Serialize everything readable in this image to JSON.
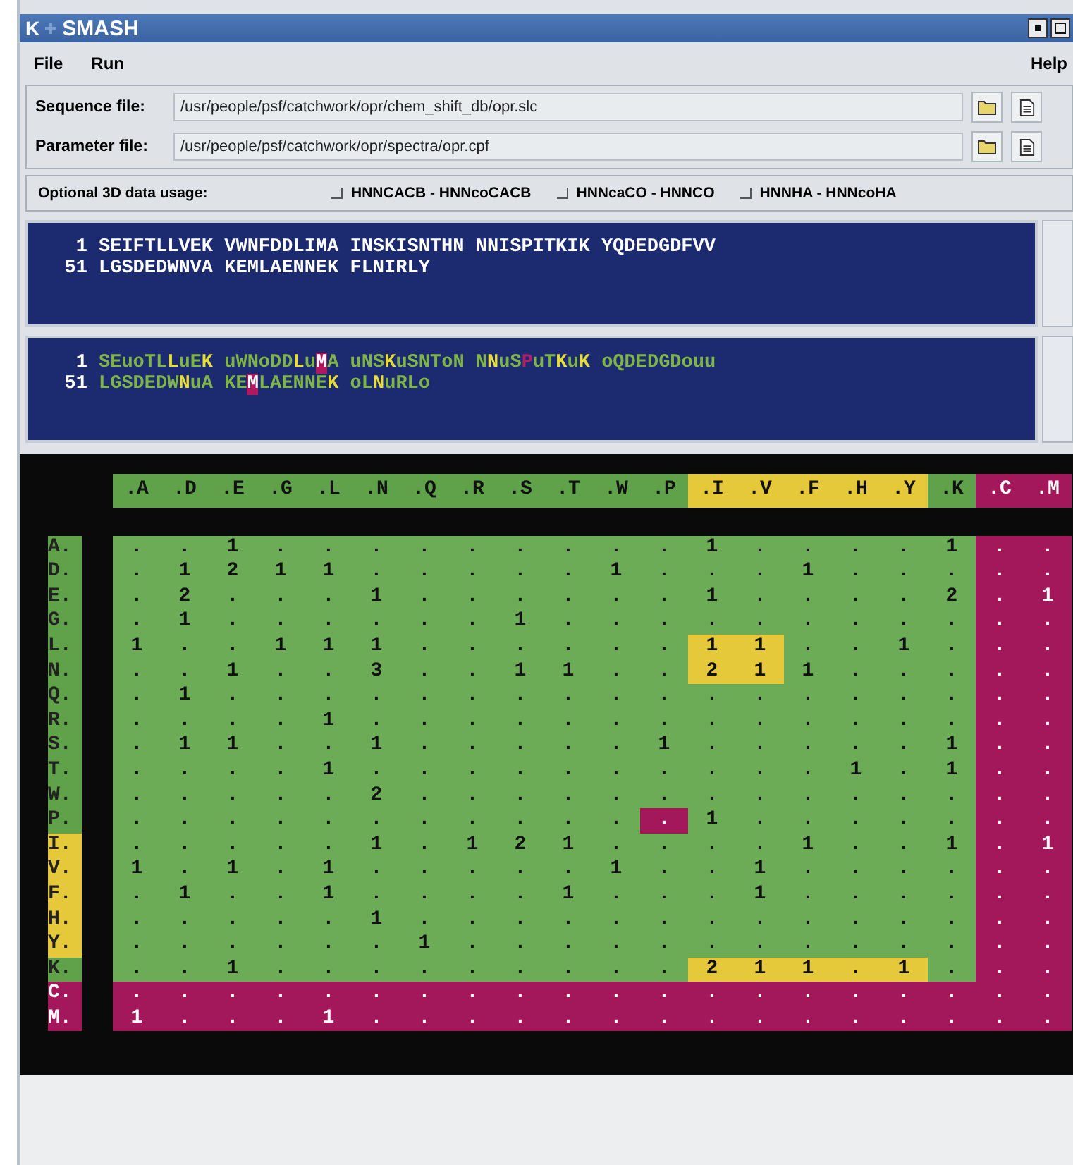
{
  "window": {
    "title": "SMASH",
    "logo": "K"
  },
  "menu": [
    {
      "label": "File"
    },
    {
      "label": "Run"
    },
    {
      "label": "Help"
    }
  ],
  "files": [
    {
      "label": "Sequence file:",
      "value": "/usr/people/psf/catchwork/opr/chem_shift_db/opr.slc"
    },
    {
      "label": "Parameter file:",
      "value": "/usr/people/psf/catchwork/opr/spectra/opr.cpf"
    }
  ],
  "options": {
    "label": "Optional 3D data usage:",
    "items": [
      {
        "label": "HNNCACB - HNNcoCACB",
        "checked": false
      },
      {
        "label": "HNNcaCO - HNNCO",
        "checked": false
      },
      {
        "label": "HNNHA - HNNcoHA",
        "checked": false
      }
    ]
  },
  "sequence": [
    {
      "number": "1",
      "text": "SEIFTLLVEK VWNFDDLIMA INSKISNTHN NNISPITKIK YQDEDGDFVV"
    },
    {
      "number": "51",
      "text": "LGSDEDWNVA KEMLAENNEK FLNIRLY"
    }
  ],
  "assignment": [
    {
      "number": "1",
      "runs": [
        {
          "text": "SEuoTL",
          "kind": "assigned"
        },
        {
          "text": "L",
          "kind": "partial"
        },
        {
          "text": "uE",
          "kind": "assigned"
        },
        {
          "text": "K",
          "kind": "partial"
        },
        {
          "text": " uWNoDD",
          "kind": "assigned"
        },
        {
          "text": "L",
          "kind": "partial"
        },
        {
          "text": "u",
          "kind": "assigned"
        },
        {
          "text": "M",
          "kind": "selected"
        },
        {
          "text": "A uNS",
          "kind": "assigned"
        },
        {
          "text": "K",
          "kind": "partial"
        },
        {
          "text": "uSNToN N",
          "kind": "assigned"
        },
        {
          "text": "N",
          "kind": "partial"
        },
        {
          "text": "uS",
          "kind": "assigned"
        },
        {
          "text": "P",
          "kind": "proline"
        },
        {
          "text": "uT",
          "kind": "assigned"
        },
        {
          "text": "K",
          "kind": "partial"
        },
        {
          "text": "u",
          "kind": "assigned"
        },
        {
          "text": "K",
          "kind": "partial"
        },
        {
          "text": " oQDEDGDouu",
          "kind": "assigned"
        }
      ]
    },
    {
      "number": "51",
      "runs": [
        {
          "text": "LGSDEDW",
          "kind": "assigned"
        },
        {
          "text": "N",
          "kind": "partial"
        },
        {
          "text": "uA KE",
          "kind": "assigned"
        },
        {
          "text": "M",
          "kind": "selected"
        },
        {
          "text": "LAENNE",
          "kind": "assigned"
        },
        {
          "text": "K",
          "kind": "partial"
        },
        {
          "text": " oL",
          "kind": "assigned"
        },
        {
          "text": "N",
          "kind": "partial"
        },
        {
          "text": "uRLo",
          "kind": "assigned"
        }
      ]
    }
  ],
  "matrix": {
    "columns": [
      {
        "label": ".A",
        "kind": "plain"
      },
      {
        "label": ".D",
        "kind": "plain"
      },
      {
        "label": ".E",
        "kind": "plain"
      },
      {
        "label": ".G",
        "kind": "plain"
      },
      {
        "label": ".L",
        "kind": "plain"
      },
      {
        "label": ".N",
        "kind": "plain"
      },
      {
        "label": ".Q",
        "kind": "plain"
      },
      {
        "label": ".R",
        "kind": "plain"
      },
      {
        "label": ".S",
        "kind": "plain"
      },
      {
        "label": ".T",
        "kind": "plain"
      },
      {
        "label": ".W",
        "kind": "plain"
      },
      {
        "label": ".P",
        "kind": "plain"
      },
      {
        "label": ".I",
        "kind": "marked"
      },
      {
        "label": ".V",
        "kind": "marked"
      },
      {
        "label": ".F",
        "kind": "marked"
      },
      {
        "label": ".H",
        "kind": "marked"
      },
      {
        "label": ".Y",
        "kind": "marked"
      },
      {
        "label": ".K",
        "kind": "plain"
      },
      {
        "label": ".C",
        "kind": "excluded"
      },
      {
        "label": ".M",
        "kind": "excluded"
      }
    ],
    "rows": [
      {
        "label": "A.",
        "kind": "plain",
        "cells": [
          ".",
          ".",
          "1",
          ".",
          ".",
          ".",
          ".",
          ".",
          ".",
          ".",
          ".",
          ".",
          "1",
          ".",
          ".",
          ".",
          ".",
          "1",
          ".",
          "."
        ]
      },
      {
        "label": "D.",
        "kind": "plain",
        "cells": [
          ".",
          "1",
          "2",
          "1",
          "1",
          ".",
          ".",
          ".",
          ".",
          ".",
          "1",
          ".",
          ".",
          ".",
          "1",
          ".",
          ".",
          ".",
          ".",
          "."
        ]
      },
      {
        "label": "E.",
        "kind": "plain",
        "cells": [
          ".",
          "2",
          ".",
          ".",
          ".",
          "1",
          ".",
          ".",
          ".",
          ".",
          ".",
          ".",
          "1",
          ".",
          ".",
          ".",
          ".",
          "2",
          ".",
          "1"
        ]
      },
      {
        "label": "G.",
        "kind": "plain",
        "cells": [
          ".",
          "1",
          ".",
          ".",
          ".",
          ".",
          ".",
          ".",
          "1",
          ".",
          ".",
          ".",
          ".",
          ".",
          ".",
          ".",
          ".",
          ".",
          ".",
          "."
        ]
      },
      {
        "label": "L.",
        "kind": "plain",
        "cells": [
          "1",
          ".",
          ".",
          "1",
          "1",
          "1",
          ".",
          ".",
          ".",
          ".",
          ".",
          ".",
          "1",
          "1",
          ".",
          ".",
          "1",
          ".",
          ".",
          "."
        ],
        "highlighted": [
          false,
          false,
          false,
          false,
          false,
          false,
          false,
          false,
          false,
          false,
          false,
          false,
          true,
          true,
          false,
          false,
          false,
          false,
          false,
          false
        ]
      },
      {
        "label": "N.",
        "kind": "plain",
        "cells": [
          ".",
          ".",
          "1",
          ".",
          ".",
          "3",
          ".",
          ".",
          "1",
          "1",
          ".",
          ".",
          "2",
          "1",
          "1",
          ".",
          ".",
          ".",
          ".",
          "."
        ],
        "highlighted": [
          false,
          false,
          false,
          false,
          false,
          false,
          false,
          false,
          false,
          false,
          false,
          false,
          true,
          true,
          false,
          false,
          false,
          false,
          false,
          false
        ]
      },
      {
        "label": "Q.",
        "kind": "plain",
        "cells": [
          ".",
          "1",
          ".",
          ".",
          ".",
          ".",
          ".",
          ".",
          ".",
          ".",
          ".",
          ".",
          ".",
          ".",
          ".",
          ".",
          ".",
          ".",
          ".",
          "."
        ]
      },
      {
        "label": "R.",
        "kind": "plain",
        "cells": [
          ".",
          ".",
          ".",
          ".",
          "1",
          ".",
          ".",
          ".",
          ".",
          ".",
          ".",
          ".",
          ".",
          ".",
          ".",
          ".",
          ".",
          ".",
          ".",
          "."
        ]
      },
      {
        "label": "S.",
        "kind": "plain",
        "cells": [
          ".",
          "1",
          "1",
          ".",
          ".",
          "1",
          ".",
          ".",
          ".",
          ".",
          ".",
          "1",
          ".",
          ".",
          ".",
          ".",
          ".",
          "1",
          ".",
          "."
        ]
      },
      {
        "label": "T.",
        "kind": "plain",
        "cells": [
          ".",
          ".",
          ".",
          ".",
          "1",
          ".",
          ".",
          ".",
          ".",
          ".",
          ".",
          ".",
          ".",
          ".",
          ".",
          "1",
          ".",
          "1",
          ".",
          "."
        ]
      },
      {
        "label": "W.",
        "kind": "plain",
        "cells": [
          ".",
          ".",
          ".",
          ".",
          ".",
          "2",
          ".",
          ".",
          ".",
          ".",
          ".",
          ".",
          ".",
          ".",
          ".",
          ".",
          ".",
          ".",
          ".",
          "."
        ]
      },
      {
        "label": "P.",
        "kind": "plain",
        "cells": [
          ".",
          ".",
          ".",
          ".",
          ".",
          ".",
          ".",
          ".",
          ".",
          ".",
          ".",
          ".",
          "1",
          ".",
          ".",
          ".",
          ".",
          ".",
          ".",
          "."
        ],
        "flagged": [
          false,
          false,
          false,
          false,
          false,
          false,
          false,
          false,
          false,
          false,
          false,
          true,
          false,
          false,
          false,
          false,
          false,
          false,
          false,
          false
        ]
      },
      {
        "label": "I.",
        "kind": "marked",
        "cells": [
          ".",
          ".",
          ".",
          ".",
          ".",
          "1",
          ".",
          "1",
          "2",
          "1",
          ".",
          ".",
          ".",
          ".",
          "1",
          ".",
          ".",
          "1",
          ".",
          "1"
        ]
      },
      {
        "label": "V.",
        "kind": "marked",
        "cells": [
          "1",
          ".",
          "1",
          ".",
          "1",
          ".",
          ".",
          ".",
          ".",
          ".",
          "1",
          ".",
          ".",
          "1",
          ".",
          ".",
          ".",
          ".",
          ".",
          "."
        ]
      },
      {
        "label": "F.",
        "kind": "marked",
        "cells": [
          ".",
          "1",
          ".",
          ".",
          "1",
          ".",
          ".",
          ".",
          ".",
          "1",
          ".",
          ".",
          ".",
          "1",
          ".",
          ".",
          ".",
          ".",
          ".",
          "."
        ]
      },
      {
        "label": "H.",
        "kind": "marked",
        "cells": [
          ".",
          ".",
          ".",
          ".",
          ".",
          "1",
          ".",
          ".",
          ".",
          ".",
          ".",
          ".",
          ".",
          ".",
          ".",
          ".",
          ".",
          ".",
          ".",
          "."
        ]
      },
      {
        "label": "Y.",
        "kind": "marked",
        "cells": [
          ".",
          ".",
          ".",
          ".",
          ".",
          ".",
          "1",
          ".",
          ".",
          ".",
          ".",
          ".",
          ".",
          ".",
          ".",
          ".",
          ".",
          ".",
          ".",
          "."
        ]
      },
      {
        "label": "K.",
        "kind": "plain",
        "cells": [
          ".",
          ".",
          "1",
          ".",
          ".",
          ".",
          ".",
          ".",
          ".",
          ".",
          ".",
          ".",
          "2",
          "1",
          "1",
          ".",
          "1",
          ".",
          ".",
          "."
        ],
        "highlighted": [
          false,
          false,
          false,
          false,
          false,
          false,
          false,
          false,
          false,
          false,
          false,
          false,
          true,
          true,
          true,
          true,
          true,
          false,
          false,
          false
        ]
      },
      {
        "label": "C.",
        "kind": "excluded",
        "cells": [
          ".",
          ".",
          ".",
          ".",
          ".",
          ".",
          ".",
          ".",
          ".",
          ".",
          ".",
          ".",
          ".",
          ".",
          ".",
          ".",
          ".",
          ".",
          ".",
          "."
        ]
      },
      {
        "label": "M.",
        "kind": "excluded",
        "cells": [
          "1",
          ".",
          ".",
          ".",
          "1",
          ".",
          ".",
          ".",
          ".",
          ".",
          ".",
          ".",
          ".",
          ".",
          ".",
          ".",
          ".",
          ".",
          ".",
          "."
        ]
      }
    ]
  }
}
